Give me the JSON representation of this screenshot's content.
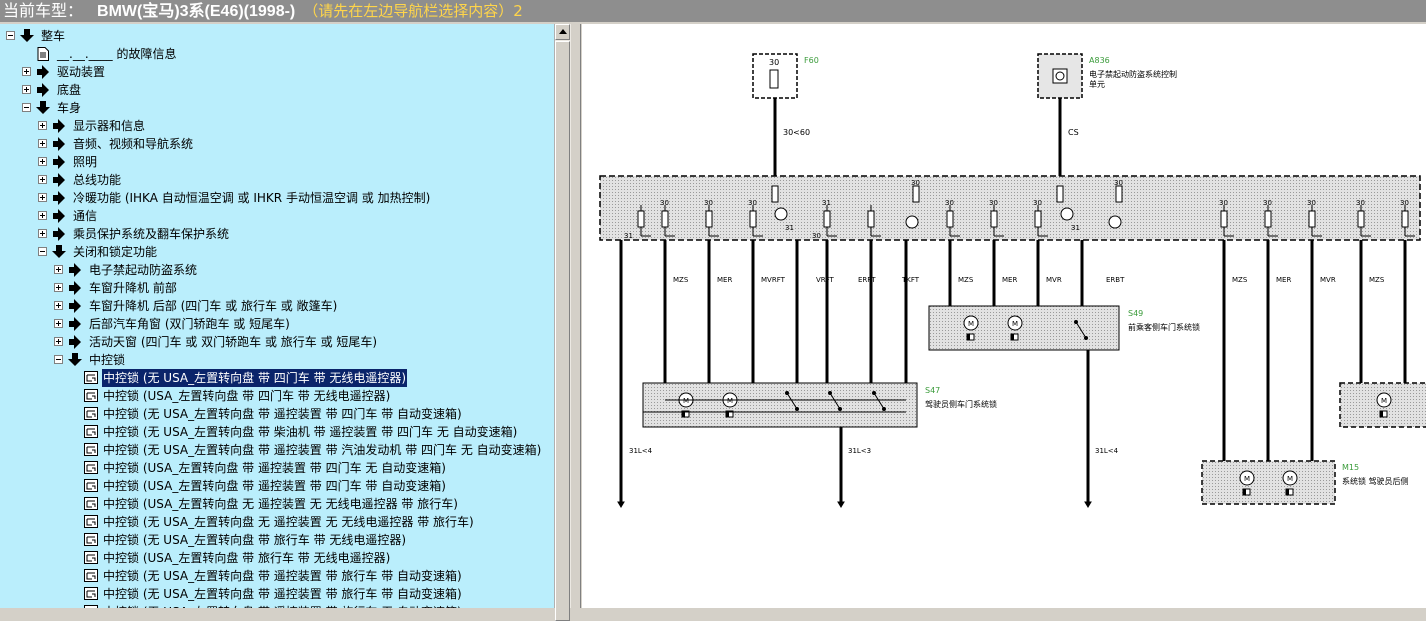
{
  "title": {
    "prefix": "当前车型：",
    "model": "BMW(宝马)3系(E46)(1998-)",
    "hint": "（请先在左边导航栏选择内容）2"
  },
  "tree": [
    {
      "label": "整车",
      "level": 0,
      "icon": "arrow-down",
      "expander": "minus"
    },
    {
      "label": "__.__.____ 的故障信息",
      "level": 1,
      "icon": "doc",
      "expander": "none"
    },
    {
      "label": "驱动装置",
      "level": 1,
      "icon": "arrow-right",
      "expander": "plus"
    },
    {
      "label": "底盘",
      "level": 1,
      "icon": "arrow-right",
      "expander": "plus"
    },
    {
      "label": "车身",
      "level": 1,
      "icon": "arrow-down",
      "expander": "minus"
    },
    {
      "label": "显示器和信息",
      "level": 2,
      "icon": "arrow-right",
      "expander": "plus"
    },
    {
      "label": "音频、视频和导航系统",
      "level": 2,
      "icon": "arrow-right",
      "expander": "plus"
    },
    {
      "label": "照明",
      "level": 2,
      "icon": "arrow-right",
      "expander": "plus"
    },
    {
      "label": "总线功能",
      "level": 2,
      "icon": "arrow-right",
      "expander": "plus"
    },
    {
      "label": "冷暖功能 (IHKA 自动恒温空调 或 IHKR 手动恒温空调 或 加热控制)",
      "level": 2,
      "icon": "arrow-right",
      "expander": "plus"
    },
    {
      "label": "通信",
      "level": 2,
      "icon": "arrow-right",
      "expander": "plus"
    },
    {
      "label": "乘员保护系统及翻车保护系统",
      "level": 2,
      "icon": "arrow-right",
      "expander": "plus"
    },
    {
      "label": "关闭和锁定功能",
      "level": 2,
      "icon": "arrow-down",
      "expander": "minus"
    },
    {
      "label": "电子禁起动防盗系统",
      "level": 3,
      "icon": "arrow-right",
      "expander": "plus"
    },
    {
      "label": "车窗升降机 前部",
      "level": 3,
      "icon": "arrow-right",
      "expander": "plus"
    },
    {
      "label": "车窗升降机 后部 (四门车 或 旅行车 或 敞篷车)",
      "level": 3,
      "icon": "arrow-right",
      "expander": "plus"
    },
    {
      "label": "后部汽车角窗 (双门轿跑车 或 短尾车)",
      "level": 3,
      "icon": "arrow-right",
      "expander": "plus"
    },
    {
      "label": "活动天窗 (四门车 或 双门轿跑车 或 旅行车 或 短尾车)",
      "level": 3,
      "icon": "arrow-right",
      "expander": "plus"
    },
    {
      "label": "中控锁",
      "level": 3,
      "icon": "arrow-down",
      "expander": "minus"
    },
    {
      "label": "中控锁 (无 USA_左置转向盘 带 四门车 带 无线电遥控器)",
      "level": 4,
      "icon": "schematic",
      "expander": "none",
      "selected": true
    },
    {
      "label": "中控锁 (USA_左置转向盘 带 四门车 带 无线电遥控器)",
      "level": 4,
      "icon": "schematic",
      "expander": "none"
    },
    {
      "label": "中控锁 (无 USA_左置转向盘 带 遥控装置 带 四门车 带 自动变速箱)",
      "level": 4,
      "icon": "schematic",
      "expander": "none"
    },
    {
      "label": "中控锁 (无 USA_左置转向盘 带 柴油机 带 遥控装置 带 四门车 无 自动变速箱)",
      "level": 4,
      "icon": "schematic",
      "expander": "none"
    },
    {
      "label": "中控锁 (无 USA_左置转向盘 带 遥控装置 带 汽油发动机 带 四门车 无 自动变速箱)",
      "level": 4,
      "icon": "schematic",
      "expander": "none"
    },
    {
      "label": "中控锁 (USA_左置转向盘 带 遥控装置 带 四门车 无 自动变速箱)",
      "level": 4,
      "icon": "schematic",
      "expander": "none"
    },
    {
      "label": "中控锁 (USA_左置转向盘 带 遥控装置 带 四门车 带 自动变速箱)",
      "level": 4,
      "icon": "schematic",
      "expander": "none"
    },
    {
      "label": "中控锁 (USA_左置转向盘 无 遥控装置 无 无线电遥控器 带 旅行车)",
      "level": 4,
      "icon": "schematic",
      "expander": "none"
    },
    {
      "label": "中控锁 (无 USA_左置转向盘 无 遥控装置 无 无线电遥控器 带 旅行车)",
      "level": 4,
      "icon": "schematic",
      "expander": "none"
    },
    {
      "label": "中控锁 (无 USA_左置转向盘 带 旅行车 带 无线电遥控器)",
      "level": 4,
      "icon": "schematic",
      "expander": "none"
    },
    {
      "label": "中控锁 (USA_左置转向盘 带 旅行车 带 无线电遥控器)",
      "level": 4,
      "icon": "schematic",
      "expander": "none"
    },
    {
      "label": "中控锁 (无 USA_左置转向盘 带 遥控装置 带 旅行车 带 自动变速箱)",
      "level": 4,
      "icon": "schematic",
      "expander": "none"
    },
    {
      "label": "中控锁 (无 USA_左置转向盘 带 遥控装置 带 旅行车 带 自动变速箱)",
      "level": 4,
      "icon": "schematic",
      "expander": "none"
    },
    {
      "label": "中控锁 (无 USA_左置转向盘 带 遥控装置 带 旅行车 无 自动变速箱)",
      "level": 4,
      "icon": "schematic",
      "expander": "none"
    }
  ],
  "diagram": {
    "fuse_f60": {
      "id": "F60",
      "pin": "30"
    },
    "a836": {
      "id": "A836",
      "desc1": "电子禁起动防盗系统控制",
      "desc2": "单元"
    },
    "feed_labels": [
      "30<60",
      "CS"
    ],
    "pin_labels": [
      "31",
      "30",
      "30",
      "30",
      "31",
      "30",
      "31",
      "30",
      "30",
      "30",
      "30",
      "31",
      "30",
      "30",
      "30",
      "30",
      "30",
      "30"
    ],
    "wire_labels": [
      "MZS",
      "MER",
      "MVRFT",
      "VRFT",
      "ERFT",
      "TKFT",
      "MZS",
      "MER",
      "MVR",
      "ERBT",
      "MZS",
      "MER",
      "MVR",
      "MZS"
    ],
    "s49": {
      "id": "S49",
      "desc": "前乘客侧车门系统锁"
    },
    "s47": {
      "id": "S47",
      "desc": "驾驶员侧车门系统锁"
    },
    "m15": {
      "id": "M15",
      "desc": "系统锁 驾驶员后侧"
    },
    "ground_labels": [
      "31L<4",
      "31L<3",
      "31L<4"
    ],
    "motor_label": "M",
    "colors": {
      "green_label": "#3a9b3a",
      "panel_bg": "#d8d8d8",
      "tree_bg": "#baeefc",
      "selection": "#0a246a"
    }
  }
}
